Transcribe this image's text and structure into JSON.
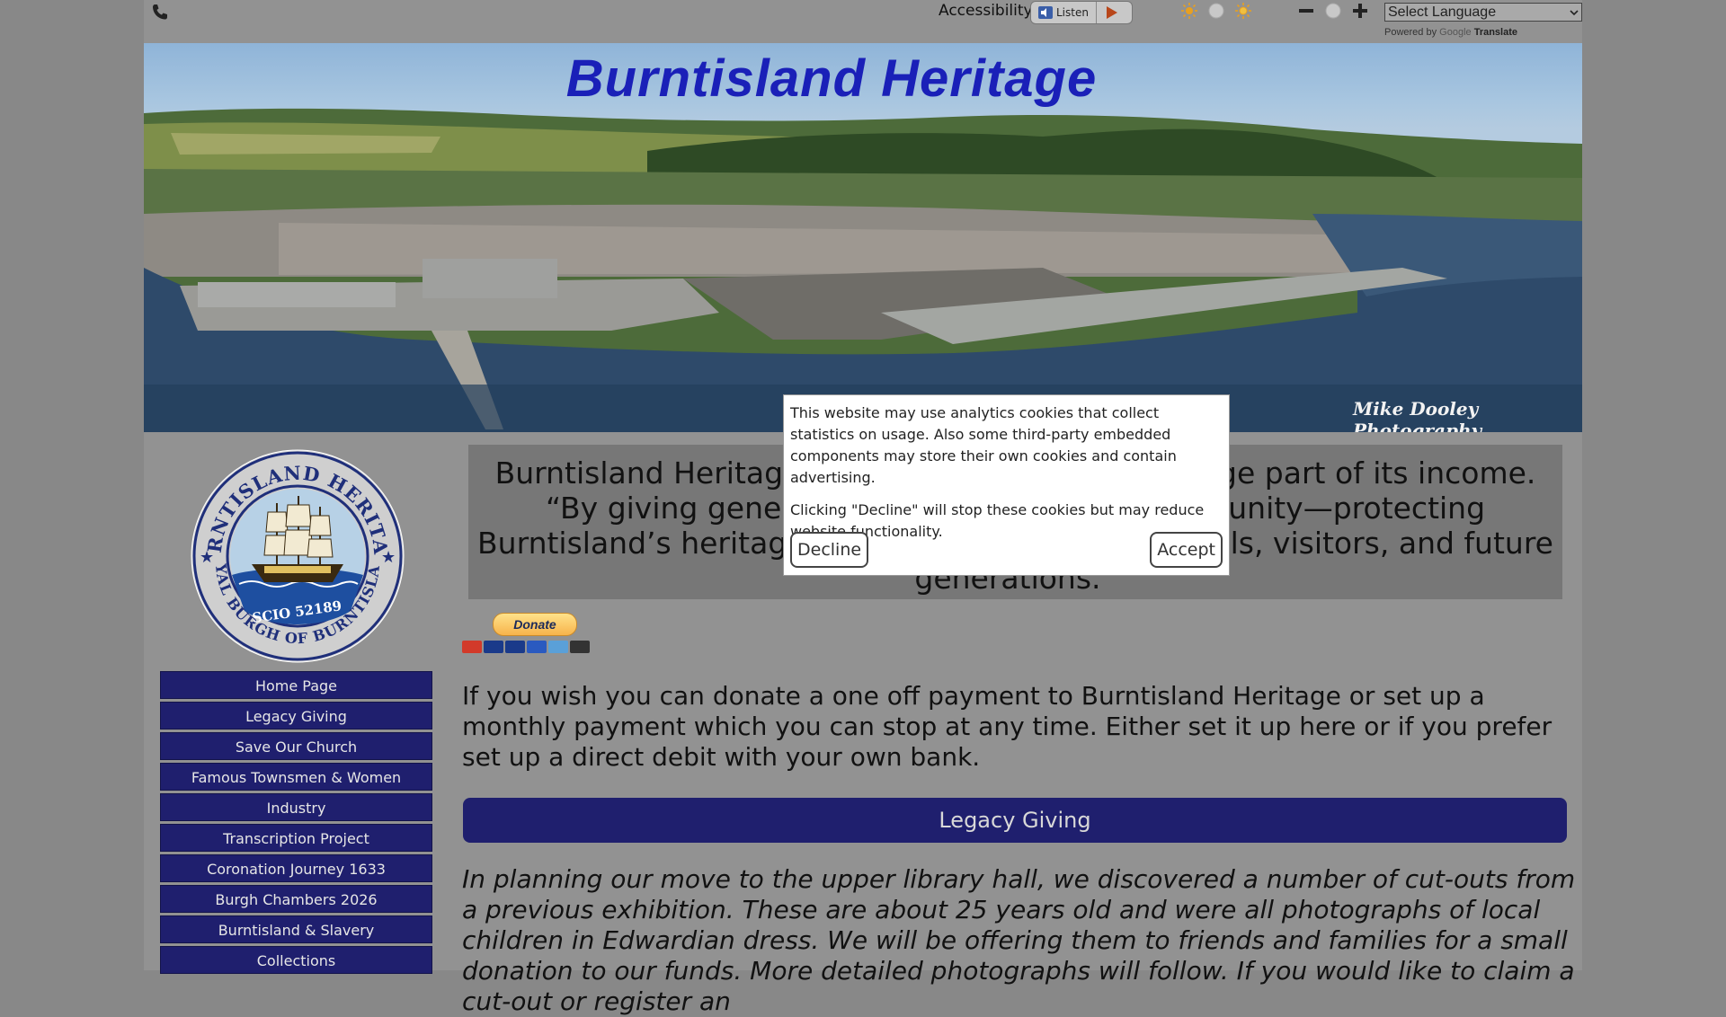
{
  "topbar": {
    "accessibility_label": "Accessibility:",
    "listen_label": "Listen",
    "select_language": "Select Language",
    "powered_by": "Powered by",
    "google": "Google",
    "translate": "Translate"
  },
  "banner": {
    "title": "Burntisland Heritage",
    "credit": "Mike Dooley Photography"
  },
  "logo": {
    "top_text": "BURNTISLAND HERITAGE",
    "bottom_text": "ROYAL BURGH OF BURNTISLAND",
    "scio": "SCIO 52189"
  },
  "nav": {
    "items": [
      {
        "label": "Home Page"
      },
      {
        "label": "Legacy Giving"
      },
      {
        "label": "Save Our Church"
      },
      {
        "label": "Famous Townsmen & Women"
      },
      {
        "label": "Industry"
      },
      {
        "label": "Transcription Project"
      },
      {
        "label": "Coronation Journey 1633"
      },
      {
        "label": "Burgh Chambers 2026"
      },
      {
        "label": "Burntisland & Slavery"
      },
      {
        "label": "Collections"
      }
    ]
  },
  "main": {
    "quote": "Burntisland Heritage relies on donations for a large part of its income. “By giving generously, you support our community—protecting Burntisland’s heritage so it can be enjoyed by locals, visitors, and future generations.”",
    "donate_label": "Donate",
    "intro": "If you wish you can donate a one off payment to Burntisland Heritage or set up a monthly payment which you can stop at any time. Either set it up here or if you prefer set up a direct debit with your own bank.",
    "legacy_heading": "Legacy Giving",
    "legacy_text": "In planning our move to the upper library hall, we discovered a number of cut-outs  from a previous exhibition. These are about 25 years old and were all photographs of local children in Edwardian dress. We will be offering them to friends and families for a small donation to our funds. More detailed photographs will follow. If you would like to claim a cut-out or register an"
  },
  "cookie": {
    "text1": "This website may use analytics cookies that collect statistics on usage. Also some third-party embedded components may store their own cookies and contain advertising.",
    "text2": "Clicking \"Decline\" will stop these cookies but may reduce website functionality.",
    "decline": "Decline",
    "accept": "Accept"
  },
  "colors": {
    "nav_bg": "#1f1f6e",
    "title_blue": "#1a20b8",
    "page_bg": "#929292"
  }
}
